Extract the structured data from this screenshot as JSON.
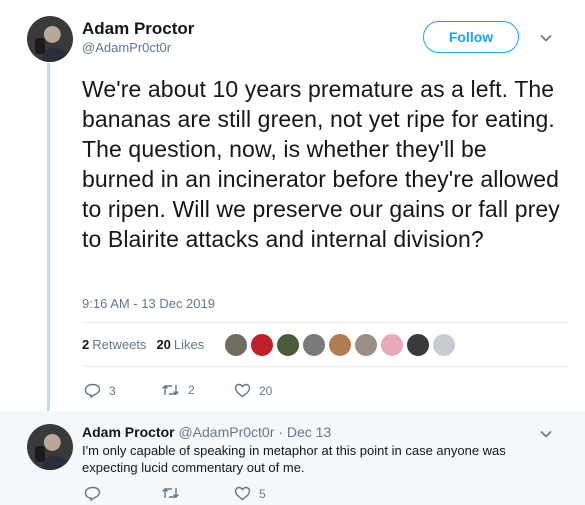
{
  "tweet": {
    "author_name": "Adam Proctor",
    "author_handle": "@AdamPr0ct0r",
    "follow_label": "Follow",
    "text": "We're about 10 years premature as a left. The bananas are still green, not yet ripe for eating. The question, now, is whether they'll be burned in an incinerator before they're allowed to ripen. Will we preserve our gains or fall prey to Blairite attacks and internal division?",
    "timestamp": "9:16 AM - 13 Dec 2019",
    "retweets_count": "2",
    "retweets_label": "Retweets",
    "likes_count": "20",
    "likes_label": "Likes",
    "actions": {
      "replies": "3",
      "retweets": "2",
      "likes": "20"
    }
  },
  "likers": [
    {
      "color": "#6f6a62"
    },
    {
      "color": "#c0202a"
    },
    {
      "color": "#4a5a3a"
    },
    {
      "color": "#7a7a7a"
    },
    {
      "color": "#b07d52"
    },
    {
      "color": "#9a8f84"
    },
    {
      "color": "#e6a9b8"
    },
    {
      "color": "#3a3a3a"
    },
    {
      "color": "#c8ccd0"
    }
  ],
  "reply": {
    "author_name": "Adam Proctor",
    "author_handle": "@AdamPr0ct0r",
    "date": "· Dec 13",
    "text": "I'm only capable of speaking in metaphor at this point in case anyone was expecting lucid commentary out of me.",
    "actions": {
      "replies": "",
      "retweets": "",
      "likes": "5"
    }
  },
  "colors": {
    "accent": "#1da1f2",
    "muted": "#657786",
    "thread_line": "#c4dbf3"
  }
}
